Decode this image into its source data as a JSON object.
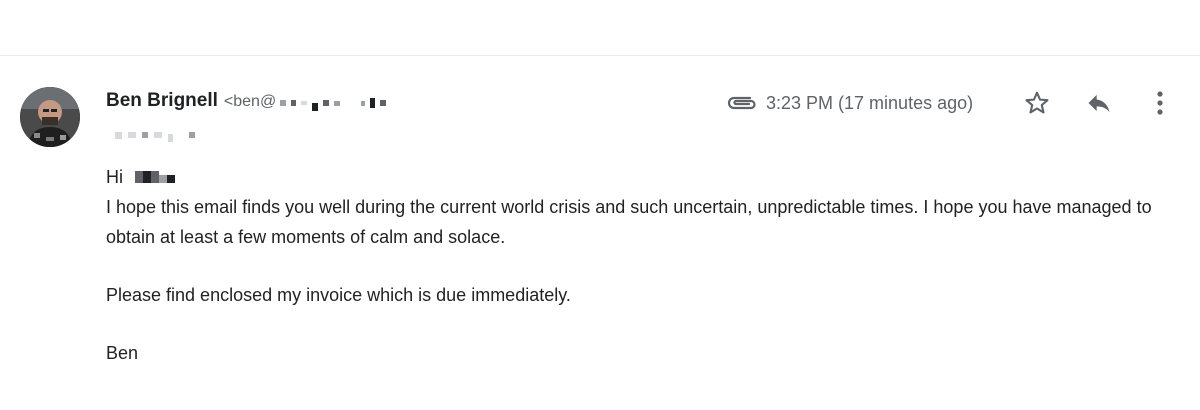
{
  "email": {
    "sender": {
      "name": "Ben Brignell",
      "email_prefix": "<ben@"
    },
    "timestamp": "3:23 PM (17 minutes ago)",
    "icons": {
      "attachment": "paperclip-icon",
      "star": "star-icon",
      "reply": "reply-icon",
      "more": "more-vert-icon"
    },
    "body": {
      "greeting": "Hi",
      "paragraph1": "I hope this email finds you well during the current world crisis and such uncertain, unpredictable times. I hope you have managed to obtain at least a few moments of calm and solace.",
      "paragraph2": "Please find enclosed my invoice which is due immediately.",
      "signoff": "Ben"
    }
  }
}
